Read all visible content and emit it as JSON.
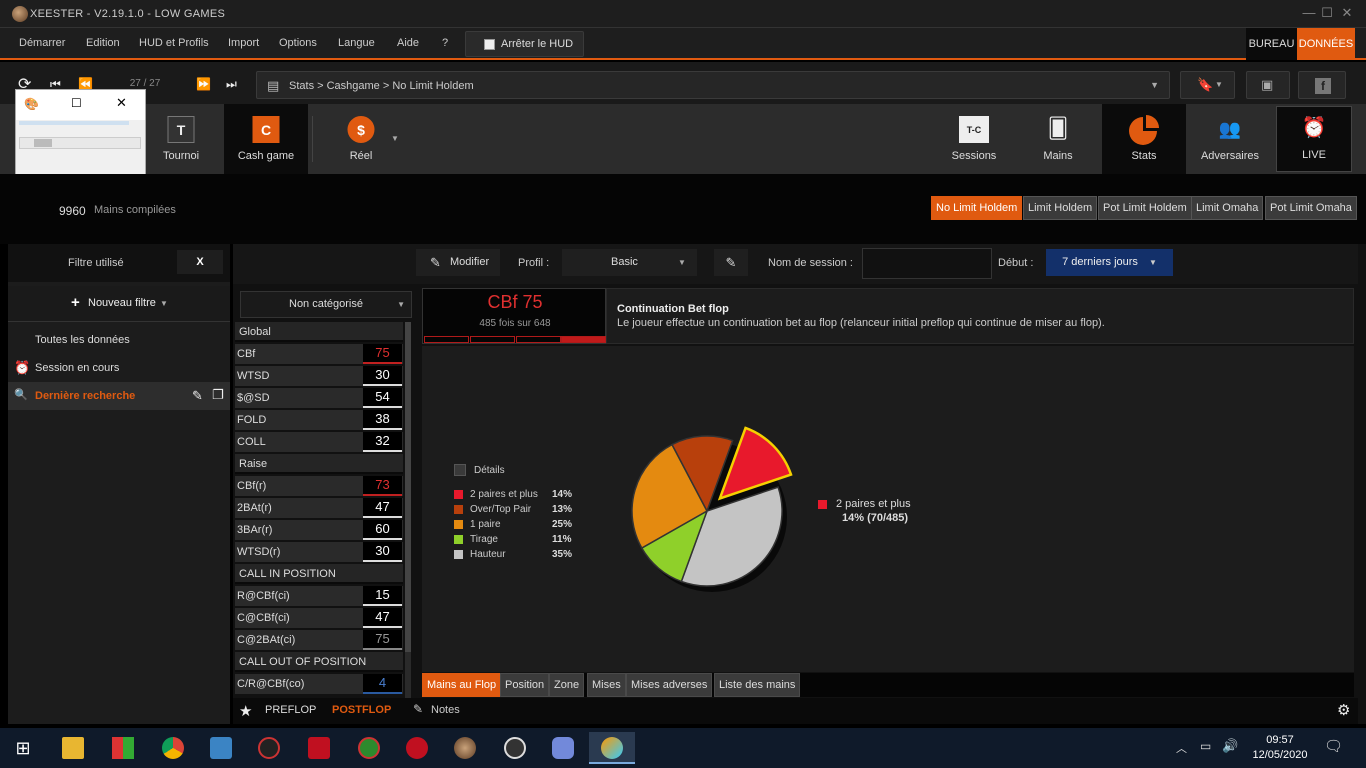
{
  "window": {
    "title": "XEESTER - V2.19.1.0 - LOW GAMES"
  },
  "menu": {
    "items": [
      "Démarrer",
      "Edition",
      "HUD et Profils",
      "Import",
      "Options",
      "Langue",
      "Aide",
      "?"
    ],
    "hud_button": "Arrêter le HUD",
    "bureau": "BUREAU",
    "donnees": "DONNÉES"
  },
  "nav": {
    "page_counter": "27 / 27",
    "breadcrumb": "Stats > Cashgame > No Limit Holdem"
  },
  "toolbar": {
    "tournoi": {
      "label": "Tournoi",
      "letter": "T"
    },
    "cash": {
      "label": "Cash game",
      "letter": "C"
    },
    "reel": {
      "label": "Réel",
      "glyph": "$"
    },
    "sessions": {
      "label": "Sessions",
      "glyph": "T-C"
    },
    "mains": {
      "label": "Mains"
    },
    "stats": {
      "label": "Stats"
    },
    "adversaires": {
      "label": "Adversaires"
    },
    "live": {
      "label": "LIVE"
    }
  },
  "info": {
    "hands_count": "9960",
    "hands_label": "Mains compilées",
    "games": [
      "No Limit Holdem",
      "Limit Holdem",
      "Pot Limit Holdem",
      "Limit Omaha",
      "Pot Limit Omaha"
    ]
  },
  "sidebar": {
    "filter_label": "Filtre utilisé",
    "filter_clear": "X",
    "new_filter": "Nouveau filtre",
    "items": [
      {
        "label": "Toutes les données",
        "icon": ""
      },
      {
        "label": "Session en cours",
        "icon": "⏰"
      },
      {
        "label": "Dernière recherche",
        "icon": "🔍"
      }
    ]
  },
  "controls": {
    "modifier": "Modifier",
    "profil_label": "Profil :",
    "profil_value": "Basic",
    "session_label": "Nom de session :",
    "session_value": "",
    "debut_label": "Début :",
    "debut_value": "7 derniers jours"
  },
  "category": "Non catégorisé",
  "stats": {
    "global_header": "Global",
    "global": [
      {
        "name": "CBf",
        "value": "75"
      },
      {
        "name": "WTSD",
        "value": "30"
      },
      {
        "name": "$@SD",
        "value": "54"
      },
      {
        "name": "FOLD",
        "value": "38"
      },
      {
        "name": "COLL",
        "value": "32"
      }
    ],
    "raise_header": "Raise",
    "raise": [
      {
        "name": "CBf(r)",
        "value": "73"
      },
      {
        "name": "2BAt(r)",
        "value": "47"
      },
      {
        "name": "3BAr(r)",
        "value": "60"
      },
      {
        "name": "WTSD(r)",
        "value": "30"
      }
    ],
    "cip_header": "CALL IN POSITION",
    "cip": [
      {
        "name": "R@CBf(ci)",
        "value": "15"
      },
      {
        "name": "C@CBf(ci)",
        "value": "47"
      },
      {
        "name": "C@2BAt(ci)",
        "value": "75"
      }
    ],
    "coop_header": "CALL OUT OF POSITION",
    "coop": [
      {
        "name": "C/R@CBf(co)",
        "value": "4"
      }
    ]
  },
  "selected_stat": {
    "title": "CBf 75",
    "subtitle": "485 fois sur 648",
    "name": "Continuation Bet flop",
    "description": "Le joueur effectue un continuation bet au flop (relanceur initial preflop qui continue de miser au flop)."
  },
  "chart_data": {
    "type": "pie",
    "legend_title": "Détails",
    "categories": [
      "2 paires et plus",
      "Over/Top Pair",
      "1 paire",
      "Tirage",
      "Hauteur"
    ],
    "values": [
      14,
      13,
      25,
      11,
      35
    ],
    "labels": [
      "14%",
      "13%",
      "25%",
      "11%",
      "35%"
    ],
    "colors": [
      "#e8192c",
      "#b8400c",
      "#e48a10",
      "#8fd02a",
      "#c4c4c4"
    ],
    "exploded_index": 0,
    "tooltip": {
      "label": "2 paires et plus",
      "value": "14% (70/485)"
    },
    "legend_position": "left"
  },
  "bottom_tabs": [
    "Mains au Flop",
    "Position",
    "Zone",
    "Mises",
    "Mises adverses",
    "Liste des mains"
  ],
  "footer": {
    "preflop": "PREFLOP",
    "postflop": "POSTFLOP",
    "notes": "Notes"
  },
  "taskbar": {
    "time": "09:57",
    "date": "12/05/2020"
  }
}
